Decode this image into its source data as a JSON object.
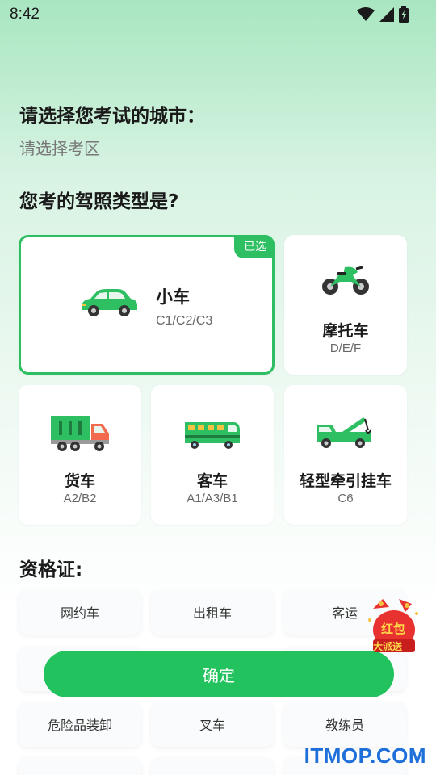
{
  "status": {
    "time": "8:42"
  },
  "city": {
    "heading": "请选择您考试的城市：",
    "placeholder": "请选择考区"
  },
  "license": {
    "heading": "您考的驾照类型是?",
    "selected_badge": "已选",
    "types": [
      {
        "label": "小车",
        "codes": "C1/C2/C3",
        "icon": "car-icon",
        "selected": true
      },
      {
        "label": "摩托车",
        "codes": "D/E/F",
        "icon": "motorcycle-icon",
        "selected": false
      },
      {
        "label": "货车",
        "codes": "A2/B2",
        "icon": "truck-icon",
        "selected": false
      },
      {
        "label": "客车",
        "codes": "A1/A3/B1",
        "icon": "bus-icon",
        "selected": false
      },
      {
        "label": "轻型牵引挂车",
        "codes": "C6",
        "icon": "tow-truck-icon",
        "selected": false
      }
    ]
  },
  "qualification": {
    "heading": "资格证:",
    "items": [
      "网约车",
      "出租车",
      "客运",
      "危险品装卸",
      "叉车",
      "教练员"
    ]
  },
  "confirm_label": "确定",
  "promo": {
    "line1": "红包",
    "line2": "大派送"
  },
  "watermark": "ITMOP.COM",
  "colors": {
    "accent": "#22c35e",
    "selected_border": "#2dbf62",
    "watermark": "#1e6fd9"
  }
}
